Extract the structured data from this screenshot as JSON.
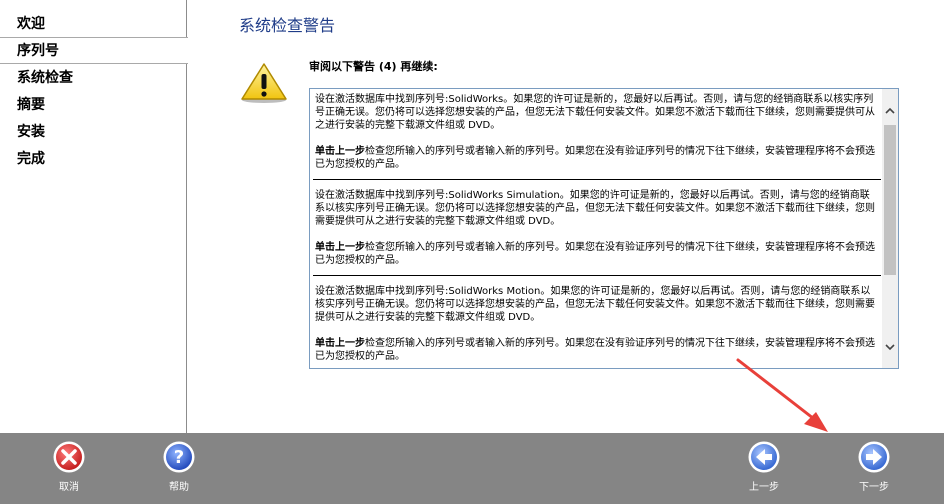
{
  "sidebar": {
    "items": [
      {
        "label": "欢迎",
        "active": false
      },
      {
        "label": "序列号",
        "active": true
      },
      {
        "label": "系统检查",
        "active": false
      },
      {
        "label": "摘要",
        "active": false
      },
      {
        "label": "安装",
        "active": false
      },
      {
        "label": "完成",
        "active": false
      }
    ]
  },
  "main": {
    "title": "系统检查警告",
    "warning_heading": "审阅以下警告 (4) 再继续:",
    "warning_icon": "warning-triangle-icon",
    "messages": [
      {
        "p1": "设在激活数据库中找到序列号:SolidWorks。如果您的许可证是新的，您最好以后再试。否则，请与您的经销商联系以核实序列号正确无误。您仍将可以选择您想安装的产品，但您无法下载任何安装文件。如果您不激活下载而往下继续，您则需要提供可从之进行安装的完整下载源文件组或 DVD。",
        "p2_pre": "单击",
        "p2_bold": "上一步",
        "p2_post": "检查您所输入的序列号或者输入新的序列号。如果您在没有验证序列号的情况下往下继续，安装管理程序将不会预选已为您授权的产品。"
      },
      {
        "p1": "设在激活数据库中找到序列号:SolidWorks Simulation。如果您的许可证是新的，您最好以后再试。否则，请与您的经销商联系以核实序列号正确无误。您仍将可以选择您想安装的产品，但您无法下载任何安装文件。如果您不激活下载而往下继续，您则需要提供可从之进行安装的完整下载源文件组或 DVD。",
        "p2_pre": "单击",
        "p2_bold": "上一步",
        "p2_post": "检查您所输入的序列号或者输入新的序列号。如果您在没有验证序列号的情况下往下继续，安装管理程序将不会预选已为您授权的产品。"
      },
      {
        "p1": "设在激活数据库中找到序列号:SolidWorks Motion。如果您的许可证是新的，您最好以后再试。否则，请与您的经销商联系以核实序列号正确无误。您仍将可以选择您想安装的产品，但您无法下载任何安装文件。如果您不激活下载而往下继续，您则需要提供可从之进行安装的完整下载源文件组或 DVD。",
        "p2_pre": "单击",
        "p2_bold": "上一步",
        "p2_post": "检查您所输入的序列号或者输入新的序列号。如果您在没有验证序列号的情况下往下继续，安装管理程序将不会预选已为您授权的产品。"
      }
    ]
  },
  "bottom": {
    "cancel_label": "取消",
    "help_label": "帮助",
    "back_label": "上一步",
    "next_label": "下一步",
    "icons": [
      "cancel-x-icon",
      "help-question-icon",
      "back-arrow-icon",
      "next-arrow-icon"
    ]
  },
  "colors": {
    "title": "#1f3c88",
    "bottom_bar": "#858585",
    "cancel_red": "#d9262c",
    "nav_blue": "#3b6fd0",
    "annotation_red": "#e8403a"
  }
}
